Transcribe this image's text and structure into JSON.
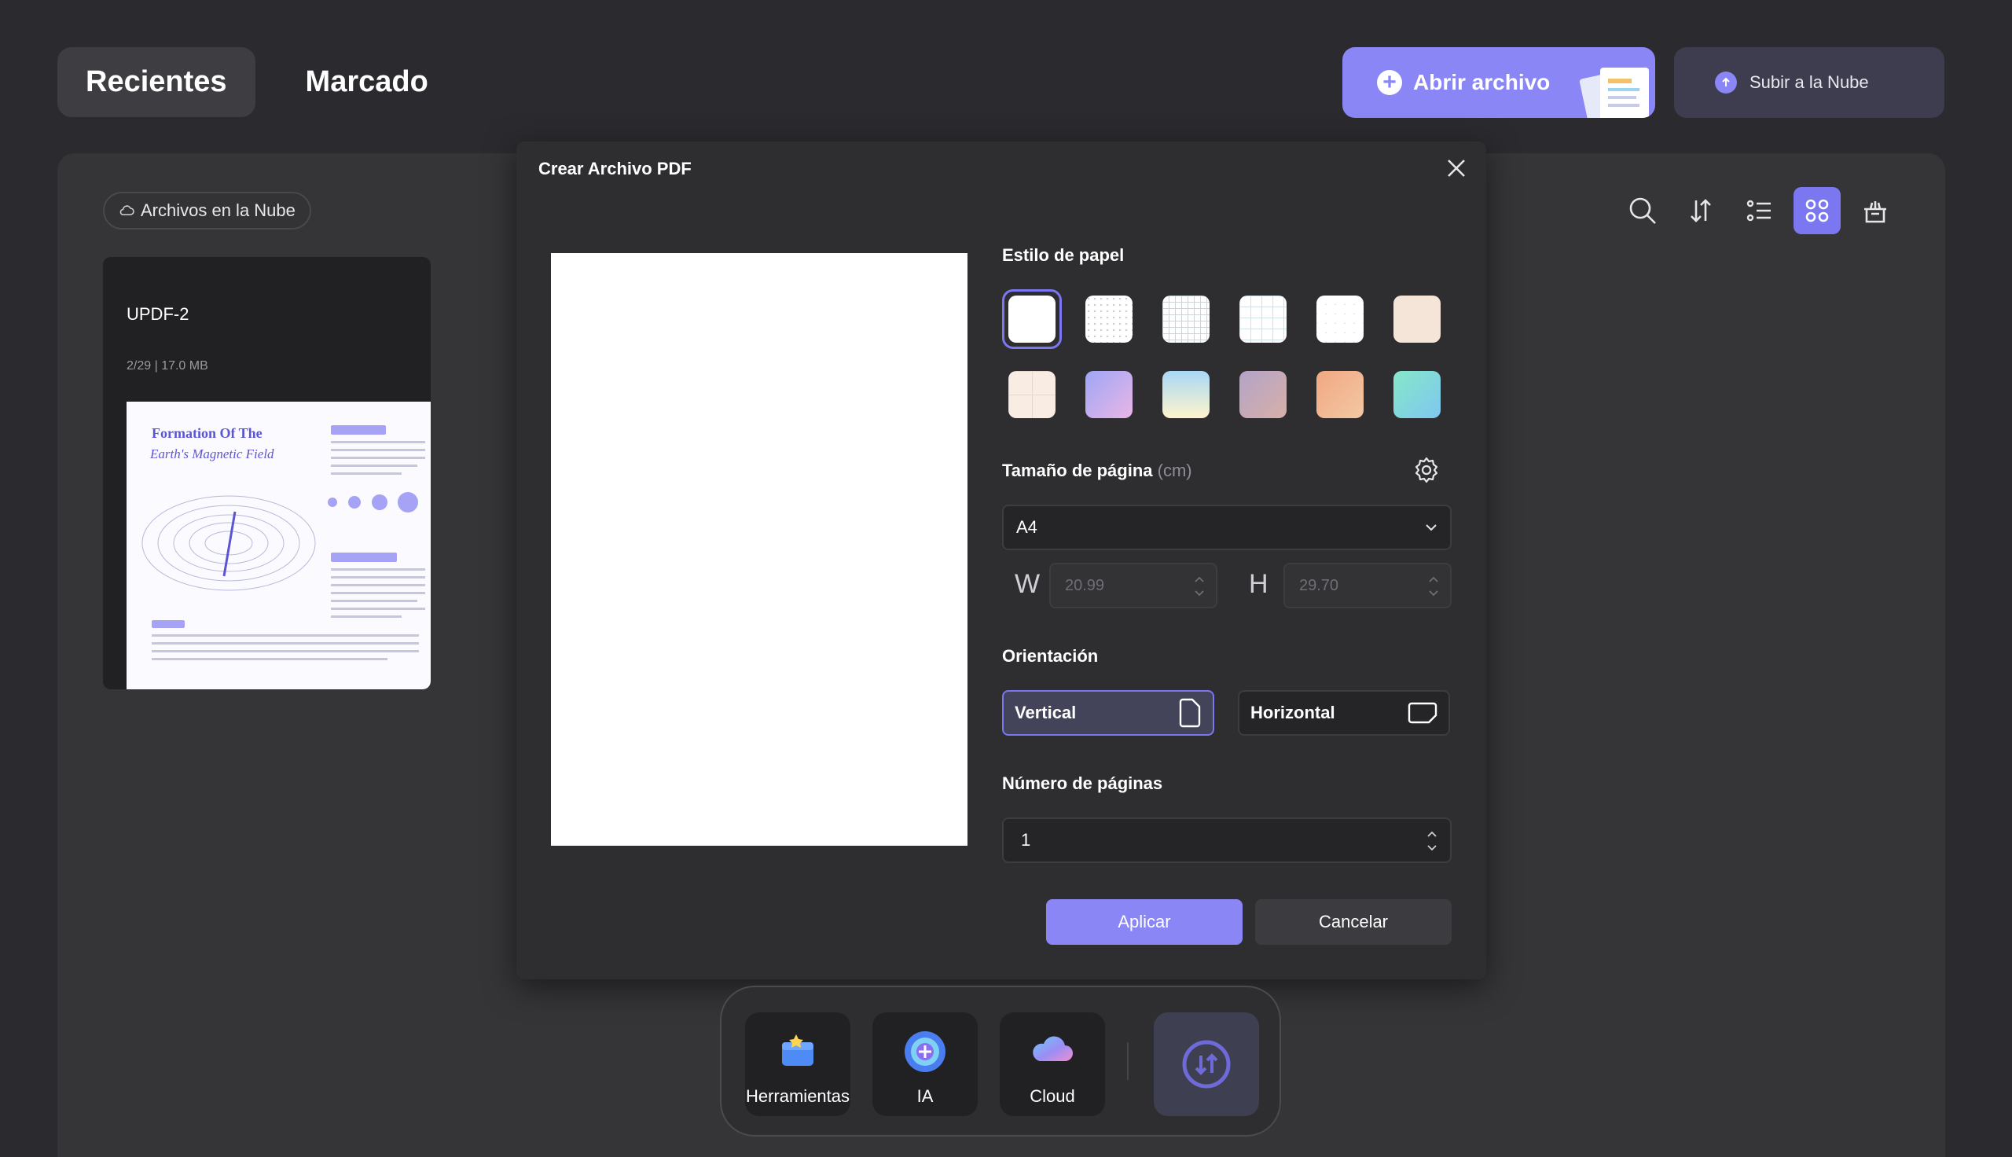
{
  "tabs": {
    "recent": "Recientes",
    "marked": "Marcado"
  },
  "header": {
    "open_file": "Abrir archivo",
    "upload_cloud": "Subir a la Nube"
  },
  "sidebar": {
    "cloud_files": "Archivos en la Nube"
  },
  "file": {
    "name": "UPDF-2",
    "meta": "2/29 | 17.0 MB",
    "thumb_title_1": "Formation Of The",
    "thumb_title_2": "Earth's Magnetic Field"
  },
  "dialog": {
    "title": "Crear Archivo PDF",
    "paper_style_label": "Estilo de papel",
    "page_size_label": "Tamaño de página",
    "page_size_unit": "(cm)",
    "page_size_value": "A4",
    "width_label": "W",
    "width_value": "20.99",
    "height_label": "H",
    "height_value": "29.70",
    "orientation_label": "Orientación",
    "orientation_vertical": "Vertical",
    "orientation_horizontal": "Horizontal",
    "pages_label": "Número de páginas",
    "pages_value": "1",
    "apply": "Aplicar",
    "cancel": "Cancelar"
  },
  "dock": {
    "tools": "Herramientas",
    "ai": "IA",
    "cloud": "Cloud"
  },
  "colors": {
    "accent": "#8a86f6",
    "background": "#2b2b2f",
    "dialog": "#2e2e31"
  }
}
